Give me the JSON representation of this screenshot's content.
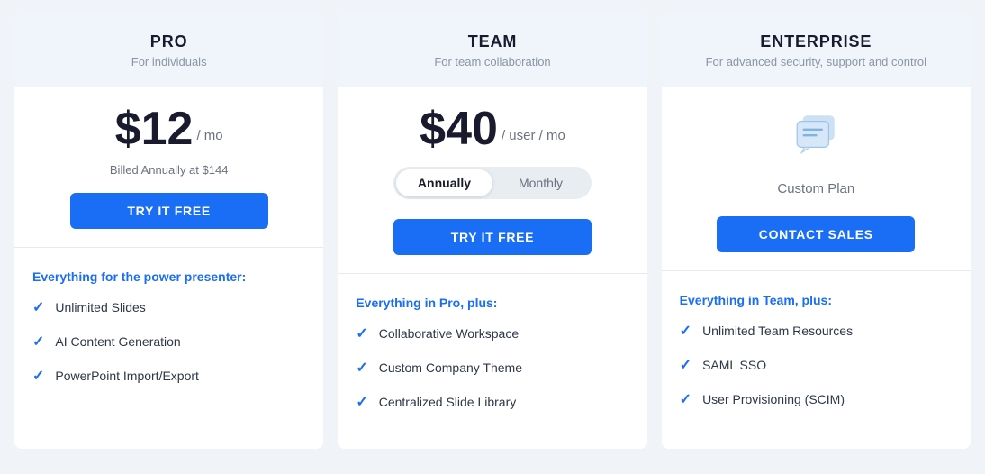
{
  "plans": [
    {
      "id": "pro",
      "name": "PRO",
      "desc": "For individuals",
      "price": "$12",
      "price_unit": "/ mo",
      "billed_note": "Billed Annually at $144",
      "cta_label": "TRY IT FREE",
      "cta_type": "primary",
      "features_heading": "Everything for the power presenter:",
      "features": [
        "Unlimited Slides",
        "AI Content Generation",
        "PowerPoint Import/Export"
      ]
    },
    {
      "id": "team",
      "name": "TEAM",
      "desc": "For team collaboration",
      "price": "$40",
      "price_unit": "/ user / mo",
      "billed_note": "",
      "cta_label": "TRY IT FREE",
      "cta_type": "primary",
      "toggle": {
        "options": [
          "Annually",
          "Monthly"
        ],
        "active": "Annually"
      },
      "features_heading": "Everything in Pro, plus:",
      "features": [
        "Collaborative Workspace",
        "Custom Company Theme",
        "Centralized Slide Library"
      ]
    },
    {
      "id": "enterprise",
      "name": "ENTERPRISE",
      "desc": "For advanced security, support and control",
      "price": null,
      "price_unit": null,
      "billed_note": null,
      "custom_plan_label": "Custom Plan",
      "cta_label": "CONTACT SALES",
      "cta_type": "outline",
      "features_heading": "Everything in Team, plus:",
      "features": [
        "Unlimited Team Resources",
        "SAML SSO",
        "User Provisioning (SCIM)"
      ]
    }
  ]
}
